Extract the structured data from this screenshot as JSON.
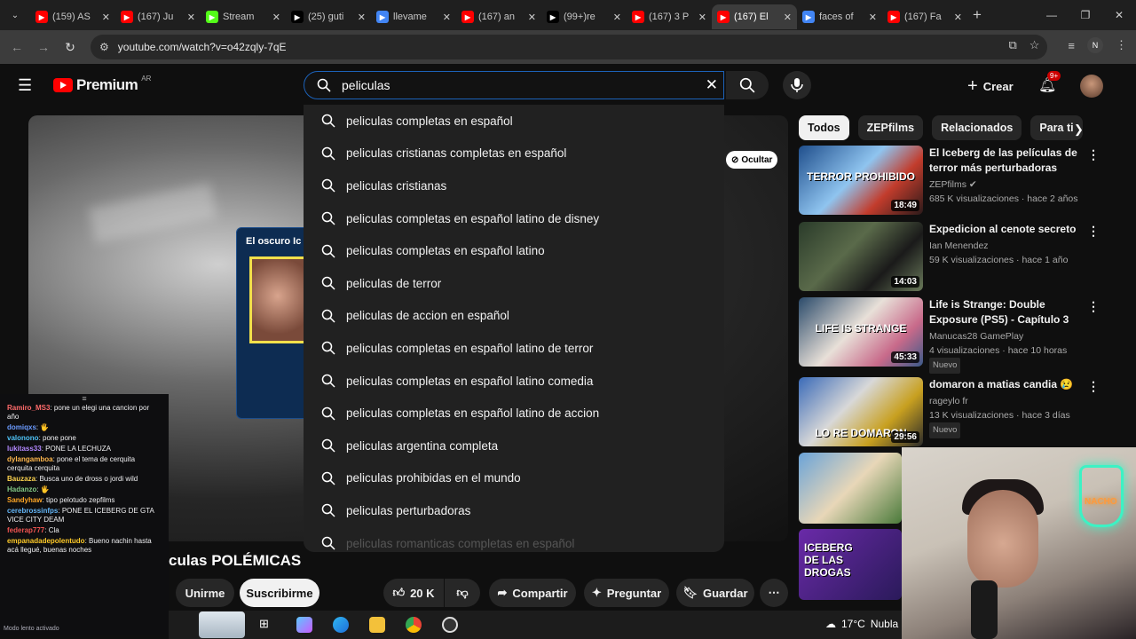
{
  "browser": {
    "tabs": [
      {
        "label": "(159) AS",
        "color": "#ff0000"
      },
      {
        "label": "(167) Ju",
        "color": "#ff0000"
      },
      {
        "label": "Stream",
        "color": "#53fc18"
      },
      {
        "label": "(25) guti",
        "color": "#000000"
      },
      {
        "label": "llevame",
        "color": "#4285f4"
      },
      {
        "label": "(167) an",
        "color": "#ff0000"
      },
      {
        "label": "(99+)re",
        "color": "#000000"
      },
      {
        "label": "(167) 3 P",
        "color": "#ff0000"
      },
      {
        "label": "(167) El",
        "color": "#ff0000"
      },
      {
        "label": "faces of",
        "color": "#4285f4"
      },
      {
        "label": "(167) Fa",
        "color": "#ff0000"
      }
    ],
    "active_tab_index": 8,
    "url": "youtube.com/watch?v=o42zqly-7qE",
    "profile_letter": "N"
  },
  "youtube": {
    "logo": "Premium",
    "country": "AR",
    "search_query": "peliculas",
    "create_label": "Crear",
    "notifications": "9+"
  },
  "suggestions": [
    "peliculas completas en español",
    "peliculas cristianas completas en español",
    "peliculas cristianas",
    "peliculas completas en español latino de disney",
    "peliculas completas en español latino",
    "peliculas de terror",
    "peliculas de accion en español",
    "peliculas completas en español latino de terror",
    "peliculas completas en español latino comedia",
    "peliculas completas en español latino de accion",
    "peliculas argentina completa",
    "peliculas prohibidas en el mundo",
    "peliculas perturbadoras",
    "peliculas romanticas completas en español"
  ],
  "player": {
    "popup_title": "El oscuro Ic",
    "hide_label": "Ocultar",
    "video_title": "culas POLÉMICAS"
  },
  "actions": {
    "join": "Unirme",
    "subscribe": "Suscribirme",
    "likes": "20 K",
    "share": "Compartir",
    "ask": "Preguntar",
    "save": "Guardar"
  },
  "chips": [
    "Todos",
    "ZEPfilms",
    "Relacionados",
    "Para ti"
  ],
  "recommendations": [
    {
      "title": "El Iceberg de las películas de terror más perturbadoras",
      "channel": "ZEPfilms",
      "verified": true,
      "meta": "685 K visualizaciones · hace 2 años",
      "duration": "18:49",
      "new": false,
      "thumb_text": "TERROR PROHIBIDO"
    },
    {
      "title": "Expedicion al cenote secreto",
      "channel": "Ian Menendez",
      "verified": false,
      "meta": "59 K visualizaciones · hace 1 año",
      "duration": "14:03",
      "new": false,
      "thumb_text": ""
    },
    {
      "title": "Life is Strange: Double Exposure (PS5) - Capítulo 3",
      "channel": "Manucas28 GamePlay",
      "verified": false,
      "meta": "4 visualizaciones · hace 10 horas",
      "duration": "45:33",
      "new": true,
      "thumb_text": "LIFE IS STRANGE"
    },
    {
      "title": "domaron a matias candia 😢",
      "channel": "rageylo fr",
      "verified": false,
      "meta": "13 K visualizaciones · hace 3 días",
      "duration": "29:56",
      "new": true,
      "thumb_text": "LO RE DOMARON"
    }
  ],
  "partial_thumbs": [
    {
      "text": ""
    },
    {
      "text": "ICEBERG DE LAS DROGAS"
    }
  ],
  "chat": {
    "messages": [
      {
        "user": "Ramiro_MS3",
        "color": "#ff6b6b",
        "text": "pone un elegi una cancion por año"
      },
      {
        "user": "domiqxs",
        "color": "#6b9bff",
        "text": "🖐"
      },
      {
        "user": "valonono",
        "color": "#4fc3f7",
        "text": "pone pone"
      },
      {
        "user": "lukitass33",
        "color": "#b388ff",
        "text": "PONE LA LECHUZA"
      },
      {
        "user": "dylangamboa",
        "color": "#ffb74d",
        "text": "pone el tema de cerquita cerquita cerquita"
      },
      {
        "user": "Bauzaza",
        "color": "#ffd54f",
        "text": "Busca uno de dross o jordi wild"
      },
      {
        "user": "Hadanzo",
        "color": "#81c784",
        "text": "🖐"
      },
      {
        "user": "Sandyhaw",
        "color": "#ffa726",
        "text": "tipo pelotudo zepfilms"
      },
      {
        "user": "cerebrossinfps",
        "color": "#64b5f6",
        "text": "PONE EL ICEBERG DE GTA VICE CITY DEAM"
      },
      {
        "user": "federap777",
        "color": "#ef5350",
        "text": "Cla"
      },
      {
        "user": "empanadadepolentudo",
        "color": "#ffca28",
        "text": "Bueno nachin hasta acá llegué, buenas noches"
      }
    ],
    "footer": "Modo lento activado"
  },
  "webcam": {
    "sign": "NACHO"
  },
  "taskbar": {
    "temp": "17°C",
    "weather": "Nubla"
  }
}
